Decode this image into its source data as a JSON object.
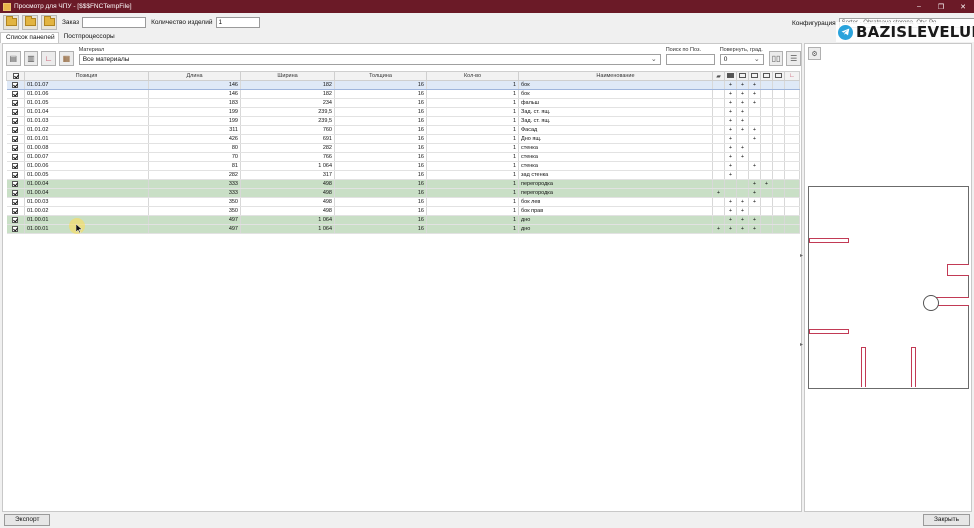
{
  "window": {
    "title": "Просмотр для ЧПУ - [$$$FNCTempFile]",
    "controls": [
      "–",
      "❐",
      "✕"
    ]
  },
  "toolbar": {
    "order_label": "Заказ",
    "order_value": "",
    "qty_label": "Количество изделий",
    "qty_value": "1",
    "config_label": "Конфигурация",
    "config_value": "Sorter - Obratnaya storona, Oty: Po"
  },
  "tabs": [
    {
      "label": "Список панелей",
      "active": true
    },
    {
      "label": "Постпроцессоры",
      "active": false
    }
  ],
  "material": {
    "caption": "Материал",
    "value": "Все материалы",
    "search_caption": "Поиск по Поз.",
    "search_value": "",
    "rotate_caption": "Повернуть, град.",
    "rotate_value": "0"
  },
  "table": {
    "headers": [
      "Позиция",
      "Длина",
      "Ширина",
      "Толщина",
      "Кол-во",
      "Наименование"
    ],
    "rows": [
      {
        "pos": "01.01.07",
        "len": "146",
        "wid": "182",
        "th": "16",
        "qty": "1",
        "name": "бок",
        "m": [
          "",
          "+",
          "+",
          "+",
          "",
          "",
          ""
        ],
        "style": "sel"
      },
      {
        "pos": "01.01.06",
        "len": "146",
        "wid": "182",
        "th": "16",
        "qty": "1",
        "name": "бок",
        "m": [
          "",
          "+",
          "+",
          "+",
          "",
          "",
          ""
        ],
        "style": ""
      },
      {
        "pos": "01.01.05",
        "len": "183",
        "wid": "234",
        "th": "16",
        "qty": "1",
        "name": "фальш",
        "m": [
          "",
          "+",
          "+",
          "+",
          "",
          "",
          ""
        ],
        "style": ""
      },
      {
        "pos": "01.01.04",
        "len": "199",
        "wid": "239,5",
        "th": "16",
        "qty": "1",
        "name": "Зад. ст. ящ.",
        "m": [
          "",
          "+",
          "+",
          "",
          "",
          "",
          ""
        ],
        "style": ""
      },
      {
        "pos": "01.01.03",
        "len": "199",
        "wid": "239,5",
        "th": "16",
        "qty": "1",
        "name": "Зад. ст. ящ.",
        "m": [
          "",
          "+",
          "+",
          "",
          "",
          "",
          ""
        ],
        "style": ""
      },
      {
        "pos": "01.01.02",
        "len": "311",
        "wid": "760",
        "th": "16",
        "qty": "1",
        "name": "Фасад",
        "m": [
          "",
          "+",
          "+",
          "+",
          "",
          "",
          ""
        ],
        "style": ""
      },
      {
        "pos": "01.01.01",
        "len": "426",
        "wid": "691",
        "th": "16",
        "qty": "1",
        "name": "Дно ящ.",
        "m": [
          "",
          "+",
          "",
          "+",
          "",
          "",
          ""
        ],
        "style": ""
      },
      {
        "pos": "01.00.08",
        "len": "80",
        "wid": "282",
        "th": "16",
        "qty": "1",
        "name": "стенка",
        "m": [
          "",
          "+",
          "+",
          "",
          "",
          "",
          ""
        ],
        "style": ""
      },
      {
        "pos": "01.00.07",
        "len": "70",
        "wid": "766",
        "th": "16",
        "qty": "1",
        "name": "стенка",
        "m": [
          "",
          "+",
          "+",
          "",
          "",
          "",
          ""
        ],
        "style": ""
      },
      {
        "pos": "01.00.06",
        "len": "81",
        "wid": "1 064",
        "th": "16",
        "qty": "1",
        "name": "стенка",
        "m": [
          "",
          "+",
          "",
          "+",
          "",
          "",
          ""
        ],
        "style": ""
      },
      {
        "pos": "01.00.05",
        "len": "282",
        "wid": "317",
        "th": "16",
        "qty": "1",
        "name": "зад стенка",
        "m": [
          "",
          "+",
          "",
          "",
          "",
          "",
          ""
        ],
        "style": ""
      },
      {
        "pos": "01.00.04",
        "len": "333",
        "wid": "498",
        "th": "16",
        "qty": "1",
        "name": "перегородка",
        "m": [
          "",
          "",
          "",
          "+",
          "+",
          "",
          ""
        ],
        "style": "hl"
      },
      {
        "pos": "01.00.04",
        "len": "333",
        "wid": "498",
        "th": "16",
        "qty": "1",
        "name": "перегородка",
        "m": [
          "+",
          "",
          "",
          "+",
          "",
          "",
          ""
        ],
        "style": "hl"
      },
      {
        "pos": "01.00.03",
        "len": "350",
        "wid": "498",
        "th": "16",
        "qty": "1",
        "name": "бок лев",
        "m": [
          "",
          "+",
          "+",
          "+",
          "",
          "",
          ""
        ],
        "style": ""
      },
      {
        "pos": "01.00.02",
        "len": "350",
        "wid": "498",
        "th": "16",
        "qty": "1",
        "name": "бок прав",
        "m": [
          "",
          "+",
          "+",
          "",
          "",
          "",
          ""
        ],
        "style": ""
      },
      {
        "pos": "01.00.01",
        "len": "497",
        "wid": "1 064",
        "th": "16",
        "qty": "1",
        "name": "дно",
        "m": [
          "",
          "+",
          "+",
          "+",
          "",
          "",
          ""
        ],
        "style": "hl"
      },
      {
        "pos": "01.00.01",
        "len": "497",
        "wid": "1 064",
        "th": "16",
        "qty": "1",
        "name": "дно",
        "m": [
          "+",
          "+",
          "+",
          "+",
          "",
          "",
          ""
        ],
        "style": "hl"
      }
    ]
  },
  "footer": {
    "export_label": "Экспорт",
    "close_label": "Закрыть"
  },
  "watermark": {
    "text": "BAZISLEVELUP"
  },
  "colors": {
    "titlebar": "#6b1a27",
    "highlight_row": "#c9dfc6",
    "selected_row": "#dfe9f7",
    "part_outline": "#c23a55"
  }
}
